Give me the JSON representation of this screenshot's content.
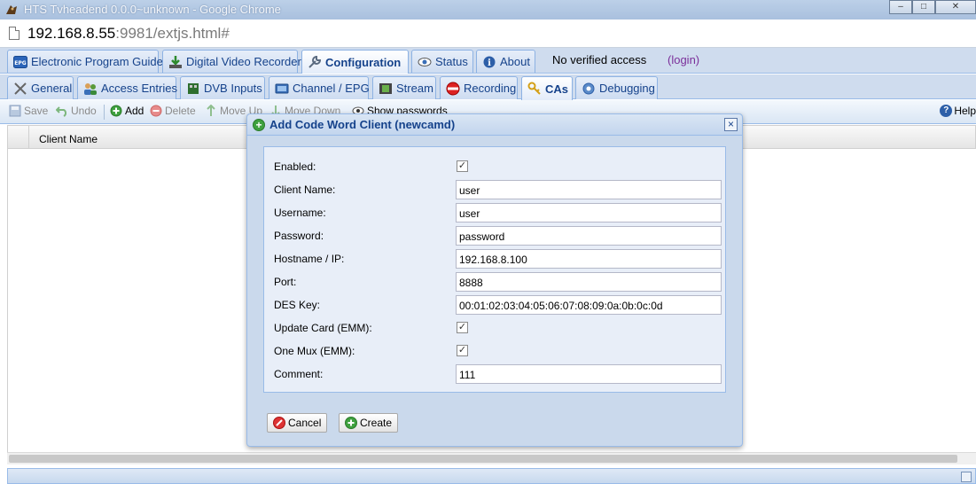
{
  "window": {
    "title": "HTS Tvheadend 0.0.0~unknown - Google Chrome",
    "minimize_label": "–",
    "maximize_label": "□",
    "close_label": "✕"
  },
  "address": {
    "host": "192.168.8.55",
    "rest": ":9981/extjs.html#"
  },
  "main_tabs": [
    {
      "label": "Electronic Program Guide",
      "icon": "epg-icon"
    },
    {
      "label": "Digital Video Recorder",
      "icon": "download-icon"
    },
    {
      "label": "Configuration",
      "icon": "wrench-icon",
      "active": true
    },
    {
      "label": "Status",
      "icon": "eye-icon"
    },
    {
      "label": "About",
      "icon": "info-icon"
    }
  ],
  "access": {
    "status": "No verified access",
    "login": "(login)"
  },
  "config_tabs": [
    {
      "label": "General",
      "icon": "tools-icon"
    },
    {
      "label": "Access Entries",
      "icon": "users-icon"
    },
    {
      "label": "DVB Inputs",
      "icon": "card-icon"
    },
    {
      "label": "Channel / EPG",
      "icon": "tv-icon"
    },
    {
      "label": "Stream",
      "icon": "film-icon"
    },
    {
      "label": "Recording",
      "icon": "rec-icon"
    },
    {
      "label": "CAs",
      "icon": "key-icon",
      "active": true
    },
    {
      "label": "Debugging",
      "icon": "bug-icon"
    }
  ],
  "toolbar": {
    "save": "Save",
    "undo": "Undo",
    "add": "Add",
    "delete": "Delete",
    "move_up": "Move Up",
    "move_down": "Move Down",
    "show_passwords": "Show passwords",
    "help": "Help"
  },
  "grid": {
    "columns": [
      "Client Name"
    ]
  },
  "dialog": {
    "title": "Add Code Word Client (newcamd)",
    "close": "×",
    "fields": {
      "enabled": {
        "label": "Enabled:",
        "checked": true
      },
      "client_name": {
        "label": "Client Name:",
        "value": "user"
      },
      "username": {
        "label": "Username:",
        "value": "user"
      },
      "password": {
        "label": "Password:",
        "value": "password"
      },
      "hostname": {
        "label": "Hostname / IP:",
        "value": "192.168.8.100"
      },
      "port": {
        "label": "Port:",
        "value": "8888"
      },
      "des_key": {
        "label": "DES Key:",
        "value": "00:01:02:03:04:05:06:07:08:09:0a:0b:0c:0d"
      },
      "update_card": {
        "label": "Update Card (EMM):",
        "checked": true
      },
      "one_mux": {
        "label": "One Mux (EMM):",
        "checked": true
      },
      "comment": {
        "label": "Comment:",
        "value": "111"
      }
    },
    "cancel": "Cancel",
    "create": "Create"
  },
  "check_mark": "✓",
  "colors": {
    "tab_text": "#15428b",
    "login": "#7b2f9a",
    "accent_border": "#99bbe8"
  }
}
